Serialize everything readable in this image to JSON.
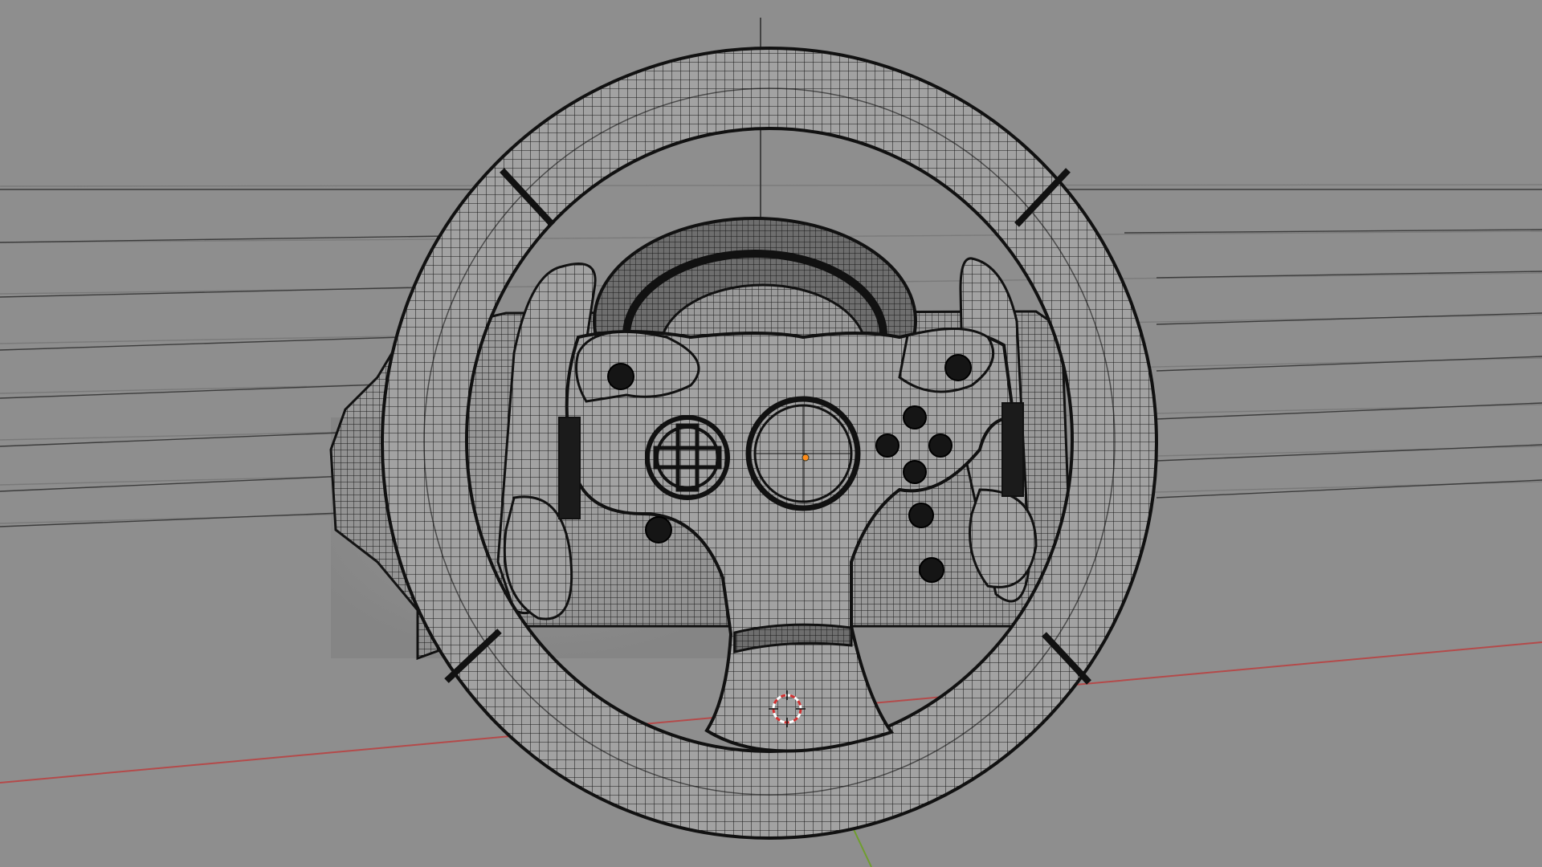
{
  "viewport": {
    "colors": {
      "background": "#8e8e8e",
      "grid_line": "#808080",
      "wire": "#1a1a1a",
      "surface": "#9c9c9c",
      "surface_dark": "#5a5a5a",
      "x_axis": "#b44a4a",
      "y_axis": "#6f9e2e",
      "origin": "#ff8c1a",
      "cursor_red": "#d03030",
      "cursor_white": "#ffffff"
    },
    "object": {
      "icon": "steering-wheel-wireframe",
      "buttons_left": "dpad",
      "buttons_right": "four-face-buttons"
    },
    "cursor_icon": "3d-cursor-icon",
    "origin_icon": "object-origin-icon"
  }
}
